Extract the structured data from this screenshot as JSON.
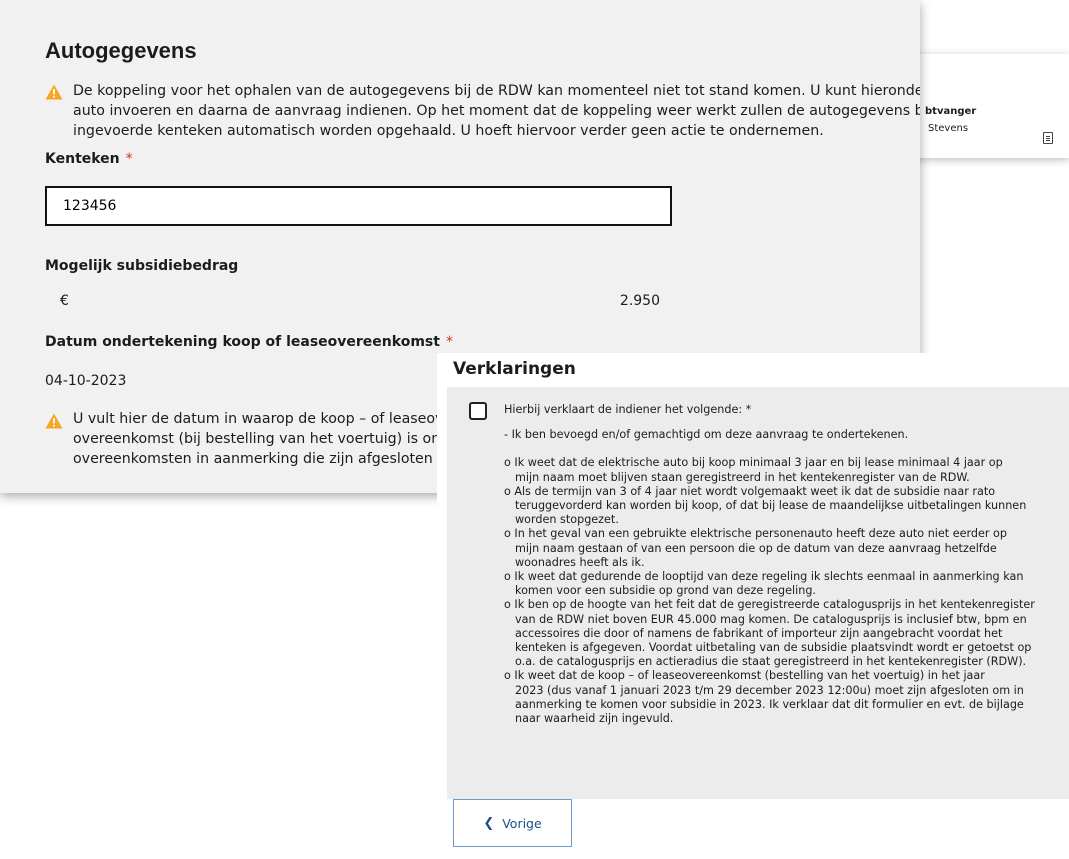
{
  "background_card": {
    "line1": "btvanger",
    "line2": "Stevens",
    "icon": "document-icon"
  },
  "form": {
    "title": "Autogegevens",
    "notice_lines": [
      "De koppeling voor het ophalen van de autogegevens bij de RDW  kan momenteel niet tot stand komen. U kunt hieronde",
      "auto invoeren en daarna de aanvraag indienen. Op het moment dat de koppeling weer werkt zullen de autogegevens be",
      "ingevoerde kenteken automatisch worden opgehaald. U hoeft hiervoor verder geen actie te ondernemen."
    ],
    "kenteken_label": "Kenteken",
    "required_mark": "*",
    "kenteken_value": "123456",
    "subsidie_label": "Mogelijk subsidiebedrag",
    "currency": "€",
    "subsidie_amount": "2.950",
    "datum_label": "Datum ondertekening koop of leaseovereenkomst",
    "datum_value": "04-10-2023",
    "datum_notice_lines": [
      "U vult hier de datum in waarop de koop – of leaseov",
      "overeenkomst (bij bestelling van het voertuig) is on",
      "overeenkomsten in aanmerking die zijn afgesloten v"
    ],
    "warning_icon": "warning-triangle-icon",
    "warning_color": "#f5a623",
    "required_color": "#d52b1e"
  },
  "verklaringen": {
    "title": "Verklaringen",
    "intro": "Hierbij verklaart de indiener het volgende: *",
    "item0": "- Ik ben bevoegd en/of gemachtigd om deze aanvraag te ondertekenen.",
    "items": [
      {
        "first": "o Ik weet dat de elektrische auto bij koop minimaal 3 jaar en bij lease minimaal 4 jaar op",
        "rest": [
          "mijn naam moet blijven staan geregistreerd in het kentekenregister van de RDW."
        ]
      },
      {
        "first": "o Als de termijn van 3 of 4 jaar niet wordt volgemaakt weet ik dat de subsidie naar rato",
        "rest": [
          "teruggevorderd kan worden bij koop, of dat bij lease de maandelijkse uitbetalingen kunnen",
          "worden stopgezet."
        ]
      },
      {
        "first": "o In het geval van een gebruikte elektrische personenauto heeft deze auto niet eerder op",
        "rest": [
          "mijn naam gestaan of van een persoon die op de datum van deze aanvraag hetzelfde",
          "woonadres heeft als ik."
        ]
      },
      {
        "first": "o Ik weet dat gedurende de looptijd van deze regeling ik slechts eenmaal in aanmerking kan",
        "rest": [
          "komen voor een subsidie op grond van deze regeling."
        ]
      },
      {
        "first": "o Ik ben op de hoogte van het feit dat de geregistreerde catalogusprijs in het kentekenregister",
        "rest": [
          "van de RDW niet boven EUR 45.000 mag komen. De catalogusprijs is inclusief btw, bpm en",
          "accessoires die door of namens de fabrikant of importeur zijn aangebracht voordat het",
          "kenteken is afgegeven. Voordat uitbetaling van de subsidie plaatsvindt wordt er getoetst op",
          "o.a. de catalogusprijs en actieradius die staat geregistreerd in het kentekenregister (RDW)."
        ]
      },
      {
        "first": "o Ik weet dat de koop – of leaseovereenkomst (bestelling van het voertuig) in het jaar",
        "rest": [
          "2023 (dus vanaf 1 januari 2023 t/m 29 december 2023 12:00u) moet zijn afgesloten om in",
          "aanmerking te komen voor subsidie in 2023. Ik verklaar dat dit formulier en evt. de bijlage",
          "naar waarheid zijn ingevuld."
        ]
      }
    ],
    "checkbox_checked": false,
    "back_button_label": "Vorige",
    "back_icon": "chevron-left-icon",
    "button_color": "#1b4f8a"
  }
}
